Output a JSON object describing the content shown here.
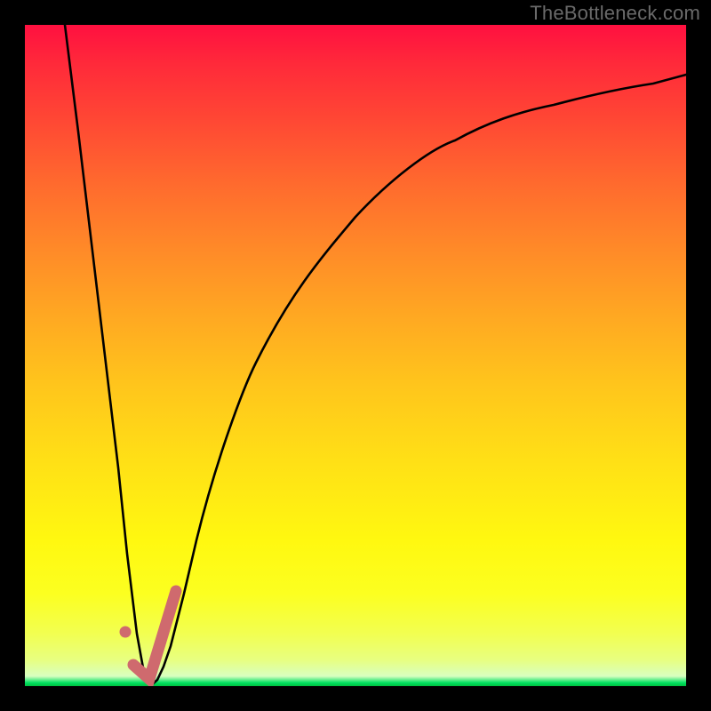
{
  "watermark": "TheBottleneck.com",
  "chart_data": {
    "type": "line",
    "title": "",
    "xlabel": "",
    "ylabel": "",
    "xlim": [
      0,
      100
    ],
    "ylim": [
      0,
      100
    ],
    "series": [
      {
        "name": "bottleneck-curve",
        "x": [
          6,
          8,
          10,
          12,
          14,
          15.5,
          17,
          18,
          19,
          20,
          21,
          22,
          24,
          26,
          30,
          35,
          40,
          45,
          50,
          55,
          60,
          65,
          70,
          75,
          80,
          85,
          90,
          95,
          100
        ],
        "y": [
          100,
          84,
          67,
          50,
          33,
          20,
          8,
          2,
          0,
          1,
          3,
          6,
          14,
          22,
          36,
          49,
          58,
          65,
          71,
          76,
          80,
          83,
          85.5,
          87.5,
          89,
          90,
          91,
          91.8,
          92.5
        ]
      }
    ],
    "markers": [
      {
        "name": "dot",
        "kind": "point",
        "x": 15.5,
        "y": 8,
        "color": "#cf6a6e"
      },
      {
        "name": "heel-top",
        "kind": "stroke",
        "from": [
          17,
          3
        ],
        "to": [
          18.5,
          1
        ],
        "color": "#cf6a6e"
      },
      {
        "name": "heel-up",
        "kind": "stroke",
        "from": [
          18.5,
          1
        ],
        "to": [
          22.5,
          14
        ],
        "color": "#cf6a6e"
      }
    ],
    "gradient_stops_pct": {
      "red": 0,
      "orange": 40,
      "yellow": 80,
      "green": 100
    }
  }
}
